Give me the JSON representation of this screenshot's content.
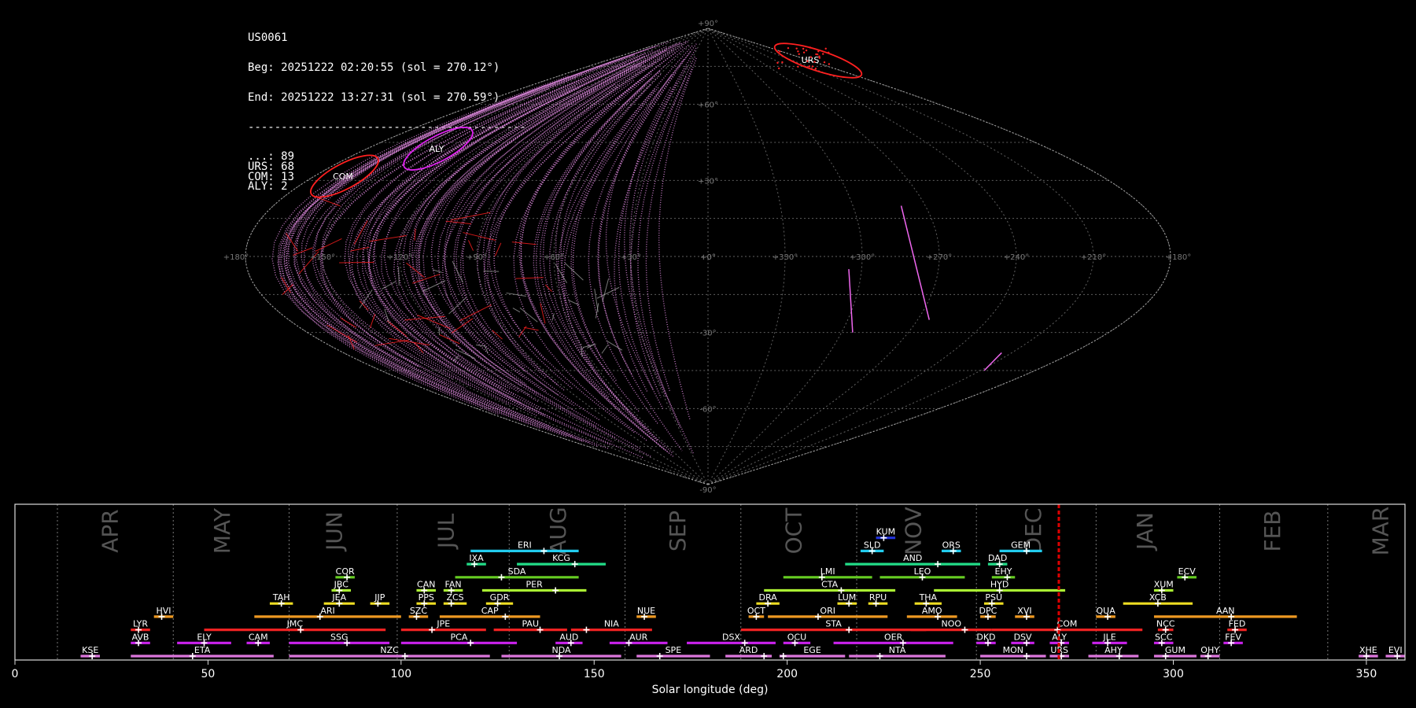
{
  "info": {
    "station": "US0061",
    "begin": "Beg: 20251222 02:20:55 (sol = 270.12°)",
    "end": "End: 20251222 13:27:31 (sol = 270.59°)",
    "separator": "------------------------------------------",
    "counts": [
      {
        "code": "...",
        "count": 89
      },
      {
        "code": "URS",
        "count": 68
      },
      {
        "code": "COM",
        "count": 13
      },
      {
        "code": "ALY",
        "count": 2
      }
    ]
  },
  "sky_map": {
    "projection": "sinusoidal",
    "ra_labels": [
      "+180°",
      "+150°",
      "+120°",
      "+90°",
      "+60°",
      "+30°",
      "+0°",
      "+330°",
      "+300°",
      "+270°",
      "+240°",
      "+210°",
      "+180°"
    ],
    "dec_labels": [
      "+90°",
      "+60°",
      "+30°",
      "+0°",
      "-30°",
      "-60°",
      "-90°"
    ],
    "radiants": [
      {
        "code": "URS",
        "color": "#ff2020"
      },
      {
        "code": "COM",
        "color": "#ff2020"
      },
      {
        "code": "ALY",
        "color": "#dd22ee"
      }
    ],
    "colors": {
      "sporadic": "#dd88dd",
      "grid": "#888888",
      "shower": "#ff2020"
    }
  },
  "chart_data": {
    "type": "timeline",
    "xlabel": "Solar longitude (deg)",
    "xlim": [
      0,
      360
    ],
    "xticks": [
      0,
      50,
      100,
      150,
      200,
      250,
      300,
      350
    ],
    "current_sol": 270.35,
    "months": [
      {
        "label": "APR",
        "boundary": 11,
        "center": 25
      },
      {
        "label": "MAY",
        "boundary": 41,
        "center": 54
      },
      {
        "label": "JUN",
        "boundary": 71,
        "center": 83
      },
      {
        "label": "JUL",
        "boundary": 99,
        "center": 112
      },
      {
        "label": "AUG",
        "boundary": 128,
        "center": 141
      },
      {
        "label": "SEP",
        "boundary": 158,
        "center": 172
      },
      {
        "label": "OCT",
        "boundary": 188,
        "center": 202
      },
      {
        "label": "NOV",
        "boundary": 218,
        "center": 233
      },
      {
        "label": "DEC",
        "boundary": 249,
        "center": 264
      },
      {
        "label": "JAN",
        "boundary": 280,
        "center": 293
      },
      {
        "label": "FEB",
        "boundary": 312,
        "center": 326
      },
      {
        "label": "MAR",
        "boundary": 340,
        "center": 354
      }
    ],
    "showers": [
      {
        "code": "KUM",
        "start": 223,
        "end": 228,
        "peak": 225,
        "row": 9,
        "color": "#2233dd"
      },
      {
        "code": "ERI",
        "start": 118,
        "end": 146,
        "peak": 137,
        "row": 8,
        "color": "#22ccee"
      },
      {
        "code": "SLD",
        "start": 219,
        "end": 225,
        "peak": 222,
        "row": 8,
        "color": "#22ccee"
      },
      {
        "code": "ORS",
        "start": 240,
        "end": 245,
        "peak": 243,
        "row": 8,
        "color": "#22ccee"
      },
      {
        "code": "GEM",
        "start": 255,
        "end": 266,
        "peak": 262,
        "row": 8,
        "color": "#22ccee"
      },
      {
        "code": "IXA",
        "start": 117,
        "end": 122,
        "peak": 119,
        "row": 7,
        "color": "#22dd88"
      },
      {
        "code": "KCG",
        "start": 130,
        "end": 153,
        "peak": 145,
        "row": 7,
        "color": "#22dd88"
      },
      {
        "code": "AND",
        "start": 215,
        "end": 250,
        "peak": 239,
        "row": 7,
        "color": "#22dd88"
      },
      {
        "code": "DAD",
        "start": 252,
        "end": 257,
        "peak": 255,
        "row": 7,
        "color": "#22dd88"
      },
      {
        "code": "COR",
        "start": 83,
        "end": 88,
        "peak": 86,
        "row": 6,
        "color": "#66cc22"
      },
      {
        "code": "SDA",
        "start": 114,
        "end": 146,
        "peak": 126,
        "row": 6,
        "color": "#66cc22"
      },
      {
        "code": "LMI",
        "start": 199,
        "end": 222,
        "peak": 209,
        "row": 6,
        "color": "#66cc22"
      },
      {
        "code": "LEO",
        "start": 224,
        "end": 246,
        "peak": 235,
        "row": 6,
        "color": "#66cc22"
      },
      {
        "code": "EHY",
        "start": 253,
        "end": 259,
        "peak": 257,
        "row": 6,
        "color": "#66cc22"
      },
      {
        "code": "ECV",
        "start": 301,
        "end": 306,
        "peak": 303,
        "row": 6,
        "color": "#66cc22"
      },
      {
        "code": "JBC",
        "start": 82,
        "end": 87,
        "peak": 84,
        "row": 5,
        "color": "#aaee33"
      },
      {
        "code": "CAN",
        "start": 104,
        "end": 109,
        "peak": 106,
        "row": 5,
        "color": "#aaee33"
      },
      {
        "code": "FAN",
        "start": 111,
        "end": 116,
        "peak": 113,
        "row": 5,
        "color": "#aaee33"
      },
      {
        "code": "PER",
        "start": 121,
        "end": 148,
        "peak": 140,
        "row": 5,
        "color": "#aaee33"
      },
      {
        "code": "CTA",
        "start": 194,
        "end": 228,
        "peak": 214,
        "row": 5,
        "color": "#aaee33"
      },
      {
        "code": "HYD",
        "start": 238,
        "end": 272,
        "peak": 255,
        "row": 5,
        "color": "#aaee33"
      },
      {
        "code": "XUM",
        "start": 295,
        "end": 300,
        "peak": 297,
        "row": 5,
        "color": "#aaee33"
      },
      {
        "code": "TAH",
        "start": 66,
        "end": 72,
        "peak": 69,
        "row": 4,
        "color": "#eedd22"
      },
      {
        "code": "JEA",
        "start": 80,
        "end": 88,
        "peak": 84,
        "row": 4,
        "color": "#eedd22"
      },
      {
        "code": "JIP",
        "start": 92,
        "end": 97,
        "peak": 94,
        "row": 4,
        "color": "#eedd22"
      },
      {
        "code": "PPS",
        "start": 104,
        "end": 109,
        "peak": 106,
        "row": 4,
        "color": "#eedd22"
      },
      {
        "code": "ZCS",
        "start": 111,
        "end": 117,
        "peak": 113,
        "row": 4,
        "color": "#eedd22"
      },
      {
        "code": "GDR",
        "start": 122,
        "end": 129,
        "peak": 125,
        "row": 4,
        "color": "#eedd22"
      },
      {
        "code": "DRA",
        "start": 192,
        "end": 198,
        "peak": 195,
        "row": 4,
        "color": "#eedd22"
      },
      {
        "code": "LUM",
        "start": 213,
        "end": 218,
        "peak": 216,
        "row": 4,
        "color": "#eedd22"
      },
      {
        "code": "RPU",
        "start": 221,
        "end": 226,
        "peak": 223,
        "row": 4,
        "color": "#eedd22"
      },
      {
        "code": "THA",
        "start": 233,
        "end": 240,
        "peak": 236,
        "row": 4,
        "color": "#eedd22"
      },
      {
        "code": "PSU",
        "start": 251,
        "end": 256,
        "peak": 253,
        "row": 4,
        "color": "#eedd22"
      },
      {
        "code": "XCB",
        "start": 287,
        "end": 305,
        "peak": 296,
        "row": 4,
        "color": "#eedd22"
      },
      {
        "code": "HVI",
        "start": 36,
        "end": 41,
        "peak": 38,
        "row": 3,
        "color": "#ee9922"
      },
      {
        "code": "ARI",
        "start": 62,
        "end": 100,
        "peak": 79,
        "row": 3,
        "color": "#ee9922"
      },
      {
        "code": "SZC",
        "start": 102,
        "end": 107,
        "peak": 104,
        "row": 3,
        "color": "#ee9922"
      },
      {
        "code": "CAP",
        "start": 110,
        "end": 136,
        "peak": 127,
        "row": 3,
        "color": "#ee9922"
      },
      {
        "code": "NUE",
        "start": 161,
        "end": 166,
        "peak": 163,
        "row": 3,
        "color": "#ee9922"
      },
      {
        "code": "OCT",
        "start": 190,
        "end": 194,
        "peak": 192,
        "row": 3,
        "color": "#ee9922"
      },
      {
        "code": "ORI",
        "start": 195,
        "end": 226,
        "peak": 208,
        "row": 3,
        "color": "#ee9922"
      },
      {
        "code": "AMO",
        "start": 231,
        "end": 244,
        "peak": 239,
        "row": 3,
        "color": "#ee9922"
      },
      {
        "code": "DPC",
        "start": 250,
        "end": 254,
        "peak": 252,
        "row": 3,
        "color": "#ee9922"
      },
      {
        "code": "XVI",
        "start": 259,
        "end": 264,
        "peak": 262,
        "row": 3,
        "color": "#ee9922"
      },
      {
        "code": "QUA",
        "start": 280,
        "end": 285,
        "peak": 283,
        "row": 3,
        "color": "#ee9922"
      },
      {
        "code": "AAN",
        "start": 295,
        "end": 332,
        "peak": 315,
        "row": 3,
        "color": "#ee9922"
      },
      {
        "code": "LYR",
        "start": 30,
        "end": 35,
        "peak": 32,
        "row": 2,
        "color": "#ee2222"
      },
      {
        "code": "JMC",
        "start": 49,
        "end": 96,
        "peak": 74,
        "row": 2,
        "color": "#ee2222"
      },
      {
        "code": "JPE",
        "start": 100,
        "end": 122,
        "peak": 108,
        "row": 2,
        "color": "#ee2222"
      },
      {
        "code": "PAU",
        "start": 124,
        "end": 143,
        "peak": 136,
        "row": 2,
        "color": "#ee2222"
      },
      {
        "code": "NIA",
        "start": 144,
        "end": 165,
        "peak": 148,
        "row": 2,
        "color": "#ee2222"
      },
      {
        "code": "STA",
        "start": 188,
        "end": 236,
        "peak": 216,
        "row": 2,
        "color": "#ee2222"
      },
      {
        "code": "NOO",
        "start": 232,
        "end": 253,
        "peak": 246,
        "row": 2,
        "color": "#ee2222"
      },
      {
        "code": "COM",
        "start": 253,
        "end": 292,
        "peak": 270,
        "row": 2,
        "color": "#ee2222"
      },
      {
        "code": "NCC",
        "start": 296,
        "end": 300,
        "peak": 298,
        "row": 2,
        "color": "#ee2222"
      },
      {
        "code": "FED",
        "start": 314,
        "end": 319,
        "peak": 316,
        "row": 2,
        "color": "#ee2222"
      },
      {
        "code": "AVB",
        "start": 30,
        "end": 35,
        "peak": 32,
        "row": 1,
        "color": "#cc22ee"
      },
      {
        "code": "ELY",
        "start": 42,
        "end": 56,
        "peak": 49,
        "row": 1,
        "color": "#cc22ee"
      },
      {
        "code": "CAM",
        "start": 60,
        "end": 66,
        "peak": 63,
        "row": 1,
        "color": "#cc22ee"
      },
      {
        "code": "SSG",
        "start": 71,
        "end": 97,
        "peak": 86,
        "row": 1,
        "color": "#cc22ee"
      },
      {
        "code": "PCA",
        "start": 100,
        "end": 130,
        "peak": 118,
        "row": 1,
        "color": "#cc22ee"
      },
      {
        "code": "AUD",
        "start": 140,
        "end": 147,
        "peak": 144,
        "row": 1,
        "color": "#cc22ee"
      },
      {
        "code": "AUR",
        "start": 154,
        "end": 169,
        "peak": 159,
        "row": 1,
        "color": "#cc22ee"
      },
      {
        "code": "DSX",
        "start": 174,
        "end": 197,
        "peak": 189,
        "row": 1,
        "color": "#cc22ee"
      },
      {
        "code": "OCU",
        "start": 199,
        "end": 206,
        "peak": 202,
        "row": 1,
        "color": "#cc22ee"
      },
      {
        "code": "OER",
        "start": 212,
        "end": 243,
        "peak": 230,
        "row": 1,
        "color": "#cc22ee"
      },
      {
        "code": "DKD",
        "start": 249,
        "end": 254,
        "peak": 252,
        "row": 1,
        "color": "#cc22ee"
      },
      {
        "code": "DSV",
        "start": 258,
        "end": 264,
        "peak": 262,
        "row": 1,
        "color": "#cc22ee"
      },
      {
        "code": "ALY",
        "start": 268,
        "end": 273,
        "peak": 271,
        "row": 1,
        "color": "#cc22ee"
      },
      {
        "code": "JLE",
        "start": 279,
        "end": 288,
        "peak": 283,
        "row": 1,
        "color": "#cc22ee"
      },
      {
        "code": "SCC",
        "start": 295,
        "end": 300,
        "peak": 297,
        "row": 1,
        "color": "#cc22ee"
      },
      {
        "code": "FEV",
        "start": 313,
        "end": 318,
        "peak": 315,
        "row": 1,
        "color": "#cc22ee"
      },
      {
        "code": "KSE",
        "start": 17,
        "end": 22,
        "peak": 20,
        "row": 0,
        "color": "#dd77dd"
      },
      {
        "code": "ETA",
        "start": 30,
        "end": 67,
        "peak": 46,
        "row": 0,
        "color": "#dd77dd"
      },
      {
        "code": "NZC",
        "start": 71,
        "end": 123,
        "peak": 101,
        "row": 0,
        "color": "#dd77dd"
      },
      {
        "code": "NDA",
        "start": 126,
        "end": 157,
        "peak": 141,
        "row": 0,
        "color": "#dd77dd"
      },
      {
        "code": "SPE",
        "start": 161,
        "end": 180,
        "peak": 167,
        "row": 0,
        "color": "#dd77dd"
      },
      {
        "code": "ARD",
        "start": 184,
        "end": 196,
        "peak": 194,
        "row": 0,
        "color": "#dd77dd"
      },
      {
        "code": "EGE",
        "start": 198,
        "end": 215,
        "peak": 199,
        "row": 0,
        "color": "#dd77dd"
      },
      {
        "code": "NTA",
        "start": 216,
        "end": 241,
        "peak": 224,
        "row": 0,
        "color": "#dd77dd"
      },
      {
        "code": "MON",
        "start": 250,
        "end": 267,
        "peak": 262,
        "row": 0,
        "color": "#dd77dd"
      },
      {
        "code": "URS",
        "start": 268,
        "end": 273,
        "peak": 271,
        "row": 0,
        "color": "#dd77dd"
      },
      {
        "code": "AHY",
        "start": 278,
        "end": 291,
        "peak": 286,
        "row": 0,
        "color": "#dd77dd"
      },
      {
        "code": "GUM",
        "start": 295,
        "end": 306,
        "peak": 298,
        "row": 0,
        "color": "#dd77dd"
      },
      {
        "code": "OHY",
        "start": 307,
        "end": 312,
        "peak": 309,
        "row": 0,
        "color": "#dd77dd"
      },
      {
        "code": "XHE",
        "start": 348,
        "end": 353,
        "peak": 350,
        "row": 0,
        "color": "#dd77dd"
      },
      {
        "code": "EVI",
        "start": 355,
        "end": 360,
        "peak": 358,
        "row": 0,
        "color": "#dd77dd"
      }
    ]
  }
}
